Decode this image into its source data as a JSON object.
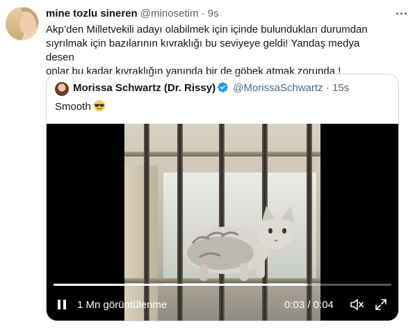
{
  "tweet": {
    "author_name": "mine tozlu sineren",
    "author_handle": "@minosetim",
    "separator": "·",
    "time": "9s",
    "text_lines": [
      "Akp’den Milletvekili adayı olabilmek için içinde bulundukları durumdan",
      "sıyrılmak için bazılarının kıvraklığı bu seviyeye geldi! Yandaş medya desen",
      "onlar bu kadar kıvraklığın yanında bir de göbek atmak zorunda !"
    ],
    "more_icon": "more-horizontal-icon"
  },
  "quote": {
    "author_name": "Morissa Schwartz (Dr. Rissy)",
    "verified_icon": "verified-badge-icon",
    "author_handle": "@MorissaSchwartz",
    "separator": "·",
    "time": "15s",
    "text": "Smooth",
    "emoji": "😎",
    "video": {
      "views": "1 Mn görüntülenme",
      "timer": "0:03 / 0:04",
      "progress": 0.75,
      "icons": [
        "pause-icon",
        "mute-icon",
        "fullscreen-icon"
      ]
    }
  },
  "colors": {
    "text": "#0f1419",
    "secondary": "#536471",
    "border": "#cfd9de",
    "verified": "#1d9bf0"
  }
}
